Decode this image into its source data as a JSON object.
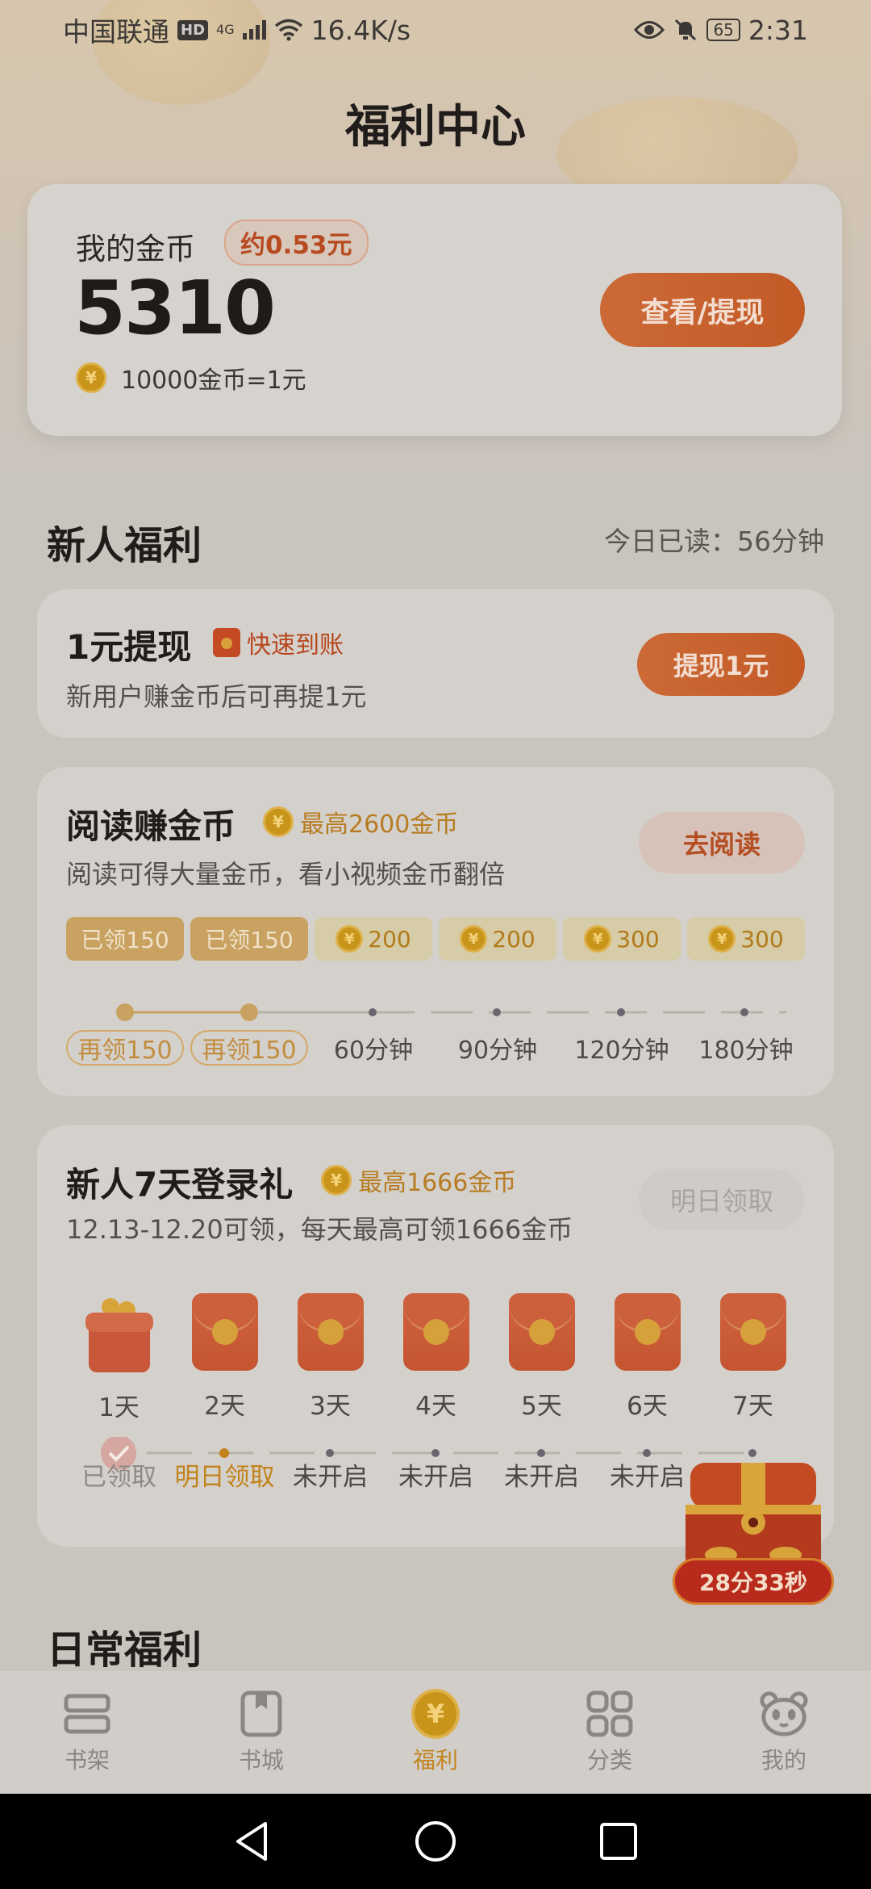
{
  "status_bar": {
    "carrier": "中国联通",
    "hd": "HD",
    "net_type": "4G",
    "speed": "16.4K/s",
    "battery": "65",
    "time": "2:31"
  },
  "page_title": "福利中心",
  "wallet": {
    "label": "我的金币",
    "approx_value": "约0.53元",
    "coins": "5310",
    "rate": "10000金币=1元",
    "button": "查看/提现"
  },
  "new_user_section": {
    "title": "新人福利",
    "read_today": "今日已读：56分钟"
  },
  "withdraw_task": {
    "title": "1元提现",
    "tag": "快速到账",
    "desc": "新用户赚金币后可再提1元",
    "button": "提现1元"
  },
  "read_task": {
    "title": "阅读赚金币",
    "max": "最高2600金币",
    "desc": "阅读可得大量金币，看小视频金币翻倍",
    "button": "去阅读",
    "rewards": [
      {
        "label": "已领150",
        "claimed": true
      },
      {
        "label": "已领150",
        "claimed": true
      },
      {
        "label": "200",
        "claimed": false
      },
      {
        "label": "200",
        "claimed": false
      },
      {
        "label": "300",
        "claimed": false
      },
      {
        "label": "300",
        "claimed": false
      }
    ],
    "milestones": [
      "再领150",
      "再领150",
      "60分钟",
      "90分钟",
      "120分钟",
      "180分钟"
    ]
  },
  "login_task": {
    "title": "新人7天登录礼",
    "max": "最高1666金币",
    "desc": "12.13-12.20可领，每天最高可领1666金币",
    "button": "明日领取",
    "days": [
      "1天",
      "2天",
      "3天",
      "4天",
      "5天",
      "6天",
      "7天"
    ],
    "statuses": [
      "已领取",
      "明日领取",
      "未开启",
      "未开启",
      "未开启",
      "未开启"
    ]
  },
  "chest": {
    "timer": "28分33秒"
  },
  "daily_section": {
    "title": "日常福利"
  },
  "tabbar": [
    {
      "label": "书架",
      "icon": "bookshelf-icon",
      "active": false
    },
    {
      "label": "书城",
      "icon": "book-icon",
      "active": false
    },
    {
      "label": "福利",
      "icon": "yuan-coin-icon",
      "active": true
    },
    {
      "label": "分类",
      "icon": "grid-icon",
      "active": false
    },
    {
      "label": "我的",
      "icon": "panda-icon",
      "active": false
    }
  ],
  "colors": {
    "accent": "#c35a26",
    "gold": "#c2831c"
  }
}
